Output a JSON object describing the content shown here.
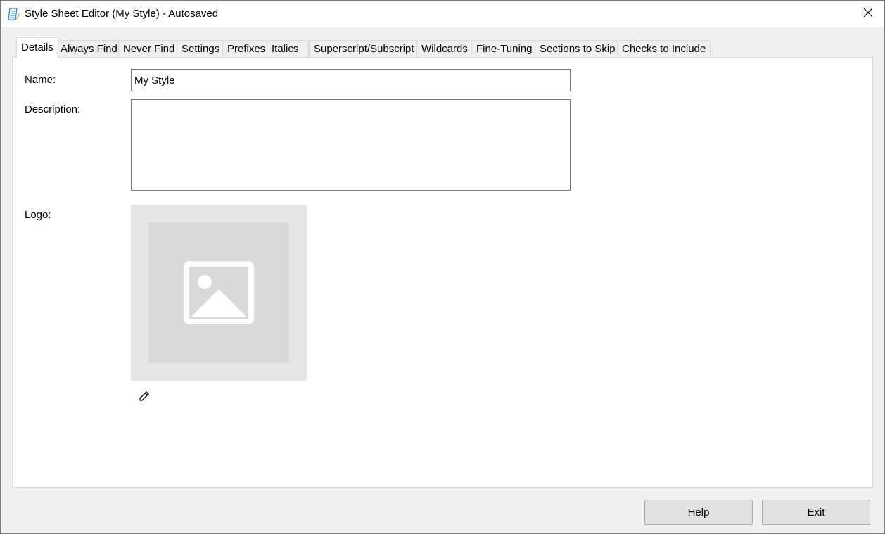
{
  "window": {
    "title": "Style Sheet Editor (My Style) - Autosaved",
    "app_icon": "style-sheet-app-icon",
    "close_icon": "close-x-icon"
  },
  "tabs": [
    {
      "label": "Details",
      "active": true
    },
    {
      "label": "Always Find",
      "active": false
    },
    {
      "label": "Never Find",
      "active": false
    },
    {
      "label": "Settings",
      "active": false
    },
    {
      "label": "Prefixes",
      "active": false
    },
    {
      "label": "Italics",
      "active": false
    },
    {
      "label": "Superscript/Subscript",
      "active": false
    },
    {
      "label": "Wildcards",
      "active": false
    },
    {
      "label": "Fine-Tuning",
      "active": false
    },
    {
      "label": "Sections to Skip",
      "active": false
    },
    {
      "label": "Checks to Include",
      "active": false
    }
  ],
  "details": {
    "name_label": "Name:",
    "name_value": "My Style",
    "description_label": "Description:",
    "description_value": "",
    "logo_label": "Logo:",
    "logo_placeholder_icon": "image-placeholder-icon",
    "edit_logo_icon": "pencil-icon"
  },
  "footer": {
    "help_label": "Help",
    "exit_label": "Exit"
  },
  "colors": {
    "window_bg": "#f0f0f0",
    "panel_bg": "#ffffff",
    "button_bg": "#e1e1e1",
    "logo_frame": "#e6e6e6",
    "logo_inner": "#d9d9d9",
    "icon_accent": "#2a8fd6"
  }
}
